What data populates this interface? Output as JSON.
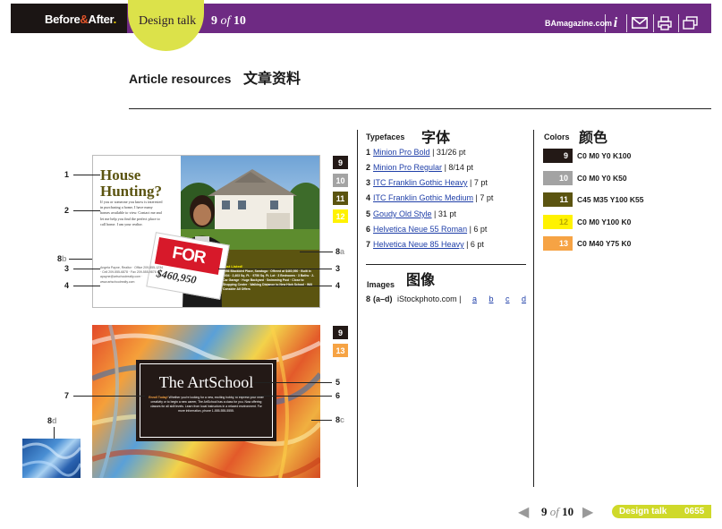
{
  "header": {
    "logo_before": "Before",
    "logo_amp": "&",
    "logo_after": "After",
    "logo_dot": ".",
    "section_tab": "Design talk",
    "page_current": "9",
    "page_of": "of",
    "page_total": "10",
    "site": "BAmagazine.com",
    "icons": [
      "info-icon",
      "email-icon",
      "print-icon",
      "window-icon"
    ],
    "colors": {
      "bar": "#6e2a83",
      "logo_bg": "#1b1514",
      "tab": "#dce24a"
    }
  },
  "title": {
    "en": "Article resources",
    "cn": "文章资料"
  },
  "ad1": {
    "headline_1": "House",
    "headline_2": "Hunting?",
    "body": "If you or someone you know is interested in purchasing a home, I have many homes available to view. Contact me and let me help you find the perfect place to call home. I am your realtor.",
    "contact": "Angela Payne, Realtor · Office 209-555-1234 · Cell 209-555-6878 · Fax 209-555-9876 · apayne@artschoolrealty.com · www.artschoolrealty.com",
    "sign": "FOR SALE",
    "price": "$460,950",
    "listing_title": "Just Listed!",
    "listing_text": "4056 Blackbird Place, Saratoga · Offered at $460,950 · Built in 2004 · 2,403 Sq. Ft. · 9750 Sq. Ft. Lot · 3 Bedrooms · 3 Baths · 2-Car Garage · Huge Backyard · Swimming Pool · Close to Shopping Center · Walking Distance to New High School · Will Consider All Offers",
    "callouts_left": [
      "1",
      "2",
      "3",
      "4"
    ],
    "callout_8b": {
      "num": "8",
      "sub": "b"
    },
    "callout_8a": {
      "num": "8",
      "sub": "a"
    },
    "callouts_right": [
      "3",
      "4"
    ],
    "swatch_tags": [
      "9",
      "10",
      "11",
      "12"
    ]
  },
  "ad2": {
    "title": "The ArtSchool",
    "body_lead": "Enroll Today!",
    "body": "Whether you're looking for a new, exciting hobby, to express your inner creativity or to begin a new career, The ArtSchool has a class for you. Now offering classes for all skill levels. Learn from local instructors in a relaxed environment. For more information, phone 1-555-555-5555.",
    "callouts_right": [
      "5",
      "6"
    ],
    "callout_7": "7",
    "callout_8c": {
      "num": "8",
      "sub": "c"
    },
    "callout_8d": {
      "num": "8",
      "sub": "d"
    },
    "swatch_tags": [
      "9",
      "13"
    ]
  },
  "typefaces": {
    "heading": "Typefaces",
    "heading_cn": "字体",
    "items": [
      {
        "num": "1",
        "name": "Minion Pro Bold",
        "detail": " | 31/26 pt"
      },
      {
        "num": "2",
        "name": "Minion Pro Regular",
        "detail": " | 8/14 pt"
      },
      {
        "num": "3",
        "name": "ITC Franklin Gothic Heavy",
        "detail": " | 7 pt"
      },
      {
        "num": "4",
        "name": "ITC Franklin Gothic Medium",
        "detail": " | 7 pt"
      },
      {
        "num": "5",
        "name": "Goudy Old Style",
        "detail": " | 31 pt"
      },
      {
        "num": "6",
        "name": "Helvetica Neue 55 Roman",
        "detail": " | 6 pt"
      },
      {
        "num": "7",
        "name": "Helvetica Neue 85 Heavy",
        "detail": " | 6 pt"
      }
    ]
  },
  "images": {
    "heading": "Images",
    "heading_cn": "图像",
    "num": "8",
    "range": "(a–d)",
    "source": "iStockphoto.com",
    "sep": "|",
    "links": [
      "a",
      "b",
      "c",
      "d"
    ]
  },
  "colors": {
    "heading": "Colors",
    "heading_cn": "颜色",
    "items": [
      {
        "num": "9",
        "hex": "#231916",
        "label": "C0 M0 Y0 K100"
      },
      {
        "num": "10",
        "hex": "#a3a3a3",
        "label": "C0 M0 Y0 K50"
      },
      {
        "num": "11",
        "hex": "#5b5410",
        "label": "C45 M35 Y100 K55"
      },
      {
        "num": "12",
        "hex": "#fff200",
        "label": "C0 M0 Y100 K0"
      },
      {
        "num": "13",
        "hex": "#f6a344",
        "label": "C0 M40 Y75 K0"
      }
    ]
  },
  "footer": {
    "page_current": "9",
    "page_of": "of",
    "page_total": "10",
    "section": "Design talk",
    "number": "0655",
    "prev": "◀",
    "next": "▶"
  }
}
